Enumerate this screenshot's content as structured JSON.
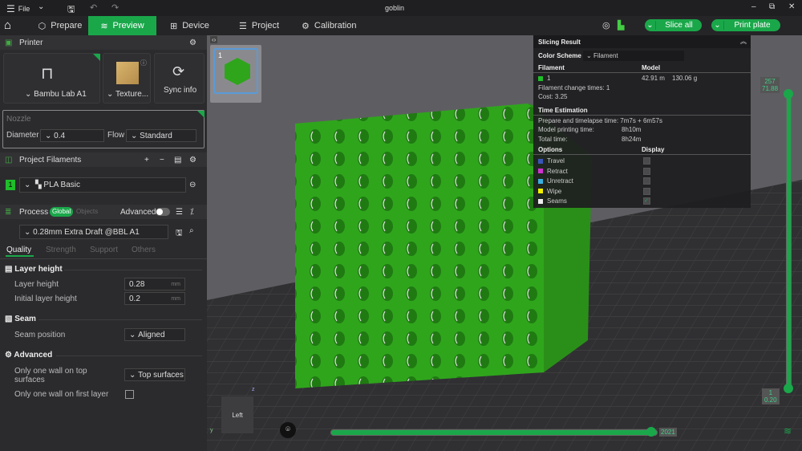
{
  "titlebar": {
    "file": "File",
    "title": "goblin"
  },
  "tabs": [
    {
      "label": "Prepare"
    },
    {
      "label": "Preview"
    },
    {
      "label": "Device"
    },
    {
      "label": "Project"
    },
    {
      "label": "Calibration"
    }
  ],
  "actions": {
    "slice": "Slice all",
    "print": "Print plate"
  },
  "printer": {
    "header": "Printer",
    "name": "Bambu Lab A1",
    "plate": "Texture...",
    "sync": "Sync info",
    "nozzle_label": "Nozzle",
    "diameter_label": "Diameter",
    "diameter": "0.4",
    "flow_label": "Flow",
    "flow": "Standard"
  },
  "filaments": {
    "header": "Project Filaments",
    "items": [
      {
        "index": "1",
        "name": "PLA Basic",
        "color": "#1fbf2a"
      }
    ]
  },
  "process": {
    "header": "Process",
    "global": "Global",
    "objects": "Objects",
    "advanced": "Advanced",
    "preset": "0.28mm Extra Draft @BBL A1",
    "tabs": [
      "Quality",
      "Strength",
      "Support",
      "Others"
    ],
    "groups": {
      "layer": "Layer height",
      "seam": "Seam",
      "advanced": "Advanced"
    },
    "layer_height_label": "Layer height",
    "layer_height": "0.28",
    "initial_label": "Initial layer height",
    "initial": "0.2",
    "unit": "mm",
    "seam_label": "Seam position",
    "seam": "Aligned",
    "one_wall_top_label": "Only one wall on top surfaces",
    "one_wall_top": "Top surfaces",
    "one_wall_first_label": "Only one wall on first layer"
  },
  "plate": {
    "number": "1"
  },
  "slicing": {
    "title": "Slicing Result",
    "scheme_label": "Color Scheme",
    "scheme": "Filament",
    "filament_h": "Filament",
    "model_h": "Model",
    "fil_index": "1",
    "length": "42.91 m",
    "weight": "130.06 g",
    "change": "Filament change times:  1",
    "cost": "Cost:  3.25",
    "time_h": "Time Estimation",
    "prepare": "Prepare and timelapse time: 7m7s + 6m57s",
    "model_time_label": "Model printing time:",
    "model_time": "8h10m",
    "total_label": "Total time:",
    "total": "8h24m",
    "options_h": "Options",
    "display_h": "Display",
    "options": [
      {
        "name": "Travel",
        "color": "#3a55b8",
        "checked": false
      },
      {
        "name": "Retract",
        "color": "#d032d0",
        "checked": false
      },
      {
        "name": "Unretract",
        "color": "#3ab0e0",
        "checked": false
      },
      {
        "name": "Wipe",
        "color": "#f0f000",
        "checked": false
      },
      {
        "name": "Seams",
        "color": "#eeeeee",
        "checked": true
      }
    ]
  },
  "vslider": {
    "top_layer": "257",
    "top_height": "71.88",
    "bottom_layer": "1",
    "bottom_height": "0.20"
  },
  "hslider": {
    "value": "2021"
  },
  "viewcube": {
    "face": "Left",
    "z": "z",
    "y": "y"
  }
}
